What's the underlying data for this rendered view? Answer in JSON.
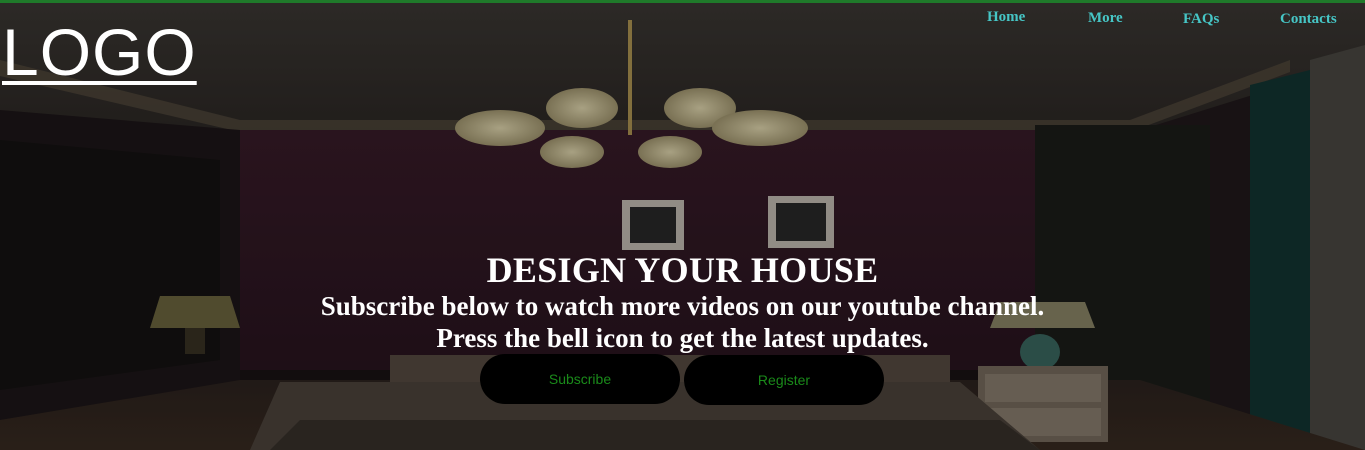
{
  "brand": {
    "logo_text": "LOGO"
  },
  "nav": {
    "items": [
      {
        "label": "Home"
      },
      {
        "label": "More"
      },
      {
        "label": "FAQs"
      },
      {
        "label": "Contacts"
      }
    ]
  },
  "hero": {
    "title": "DESIGN YOUR HOUSE",
    "line1": "Subscribe below to watch more videos on our youtube channel.",
    "line2": "Press the bell icon to get the latest updates.",
    "buttons": {
      "subscribe_label": "Subscribe",
      "register_label": "Register"
    }
  },
  "colors": {
    "accent_line": "#1f7a2a",
    "nav_link": "#46c6c6",
    "button_text": "#1a8a1a",
    "button_bg": "#000000"
  }
}
